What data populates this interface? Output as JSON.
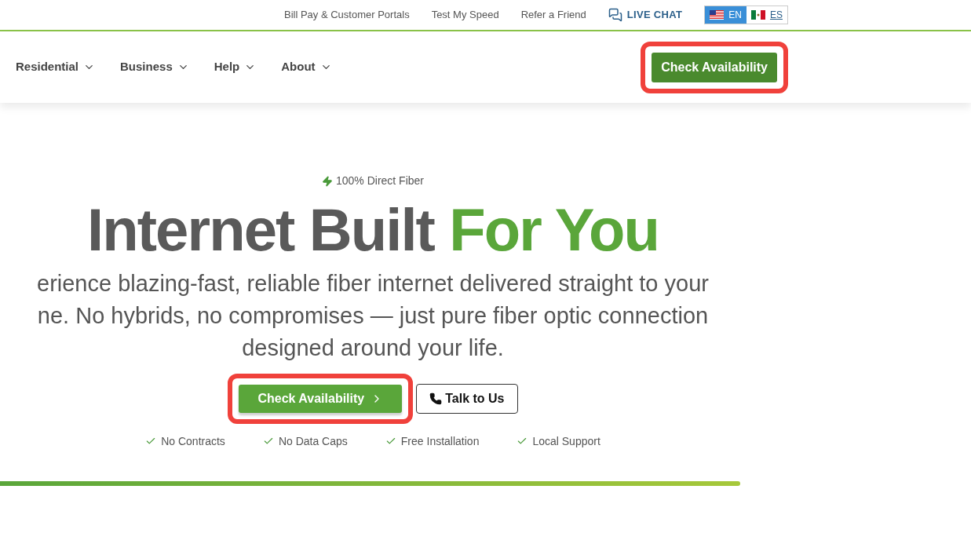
{
  "top_bar": {
    "links": [
      "Bill Pay & Customer Portals",
      "Test My Speed",
      "Refer a Friend"
    ],
    "chat": "LIVE CHAT",
    "languages": [
      {
        "label": "EN",
        "kind": "us",
        "selected": true
      },
      {
        "label": "ES",
        "kind": "mx",
        "selected": false
      }
    ]
  },
  "nav": {
    "items": [
      "Residential",
      "Business",
      "Help",
      "About"
    ],
    "cta": {
      "label": "Check Availability",
      "highlighted": true
    }
  },
  "hero": {
    "badge": "100% Direct Fiber",
    "title_plain": "Internet Built",
    "title_accent": "For You",
    "lines": [
      "erience blazing-fast, reliable fiber internet delivered straight to your",
      "ne. No hybrids, no compromises — just pure fiber optic connection",
      "designed around your life."
    ],
    "primary": {
      "label": "Check Availability",
      "highlighted": true
    },
    "secondary": {
      "label": "Talk to Us"
    },
    "features": [
      "No Contracts",
      "No Data Caps",
      "Free Installation",
      "Local Support"
    ]
  }
}
